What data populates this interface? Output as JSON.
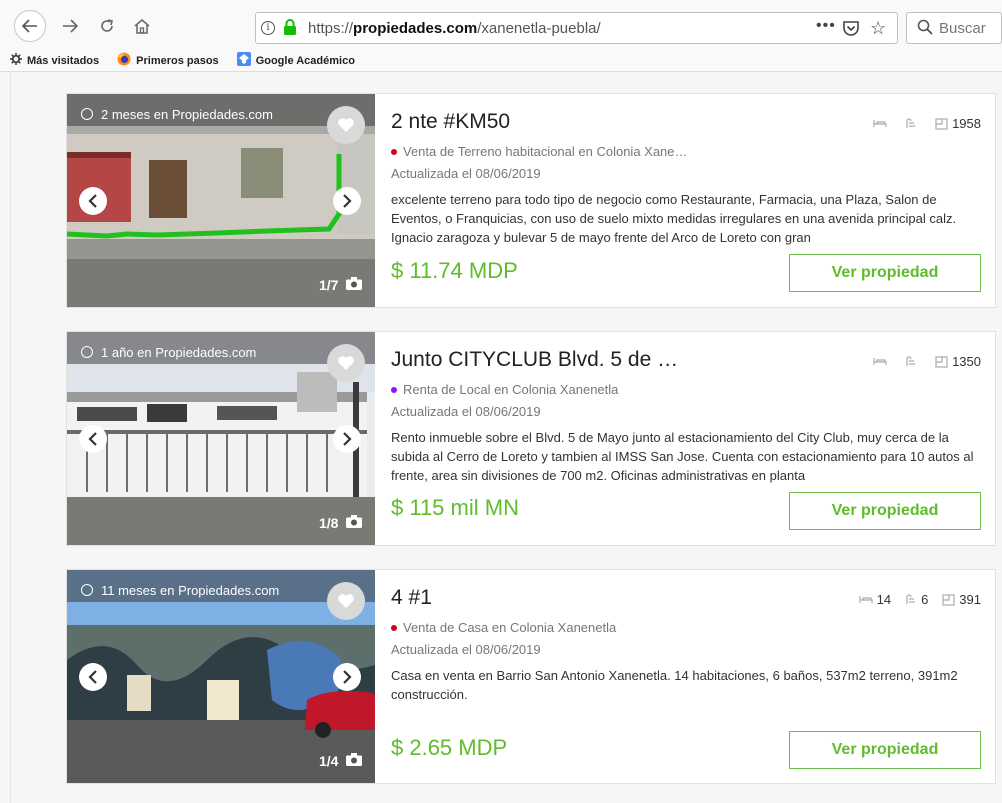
{
  "browser": {
    "url_prefix": "https://",
    "url_domain": "propiedades.com",
    "url_path": "/xanenetla-puebla/",
    "search_placeholder": "Buscar",
    "more_label": "•••"
  },
  "bookmarks": [
    {
      "label": "Más visitados",
      "icon": "gear-icon"
    },
    {
      "label": "Primeros pasos",
      "icon": "firefox-icon"
    },
    {
      "label": "Google Académico",
      "icon": "scholar-icon"
    }
  ],
  "listings": [
    {
      "time_badge": "2 meses en Propiedades.com",
      "title": "2 nte #KM50",
      "specs": {
        "beds": "",
        "baths": "",
        "area": "1958"
      },
      "dot_color": "#d0021b",
      "type": "Venta de Terreno habitacional en Colonia Xane…",
      "updated": "Actualizada el 08/06/2019",
      "description": "excelente terreno para todo tipo de negocio como Restaurante, Farmacia, una Plaza, Salon de Eventos, o Franquicias, con uso de suelo mixto medidas irregulares en una avenida principal calz. Ignacio zaragoza y bulevar 5 de mayo frente del Arco de Loreto con gran",
      "price": "$ 11.74 MDP",
      "photo_counter": "1/7",
      "button": "Ver propiedad"
    },
    {
      "time_badge": "1 año en Propiedades.com",
      "title": "Junto CITYCLUB Blvd. 5 de …",
      "specs": {
        "beds": "",
        "baths": "",
        "area": "1350"
      },
      "dot_color": "#9013fe",
      "type": "Renta de Local en Colonia Xanenetla",
      "updated": "Actualizada el 08/06/2019",
      "description": "Rento inmueble sobre el Blvd. 5 de Mayo junto al estacionamiento del City Club, muy cerca de la subida al Cerro de Loreto y tambien al IMSS San Jose. Cuenta con estacionamiento para 10 autos al frente, area sin divisiones de 700 m2. Oficinas administrativas en planta",
      "price": "$ 115 mil MN",
      "photo_counter": "1/8",
      "button": "Ver propiedad"
    },
    {
      "time_badge": "11 meses en Propiedades.com",
      "title": "4 #1",
      "specs": {
        "beds": "14",
        "baths": "6",
        "area": "391"
      },
      "dot_color": "#d0021b",
      "type": "Venta de Casa en Colonia Xanenetla",
      "updated": "Actualizada el 08/06/2019",
      "description": "Casa en venta en Barrio San Antonio Xanenetla. 14 habitaciones, 6 baños, 537m2 terreno, 391m2 construcción.",
      "price": "$ 2.65 MDP",
      "photo_counter": "1/4",
      "button": "Ver propiedad"
    }
  ],
  "colors": {
    "accent": "#5fbc2b",
    "lock": "#12bc00"
  }
}
